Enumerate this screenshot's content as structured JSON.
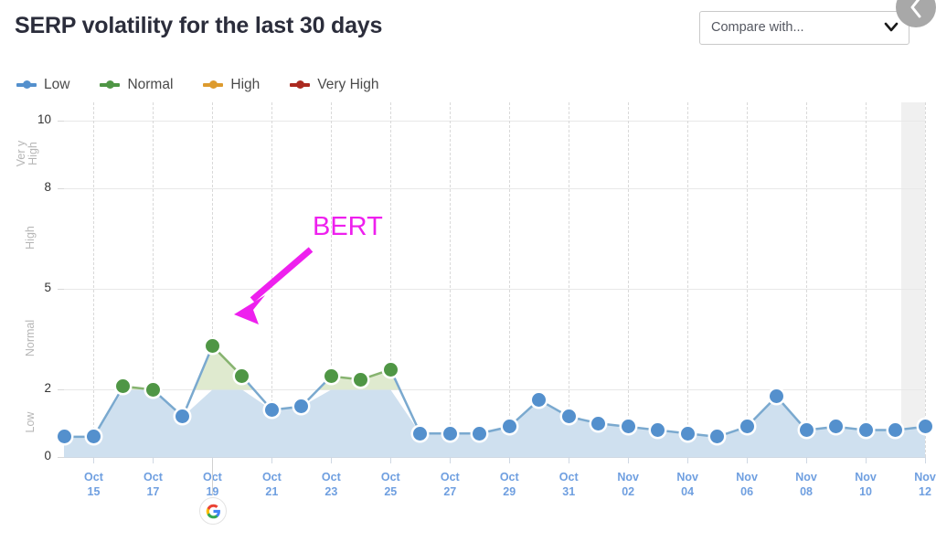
{
  "header": {
    "title": "SERP volatility for the last 30 days",
    "compare_placeholder": "Compare with...",
    "caret_icon": "chevron-down-icon",
    "collapse_icon": "chevron-left-icon"
  },
  "legend": {
    "items": [
      {
        "label": "Low",
        "color": "#5490cd"
      },
      {
        "label": "Normal",
        "color": "#4f9645"
      },
      {
        "label": "High",
        "color": "#dd9b2e"
      },
      {
        "label": "Very High",
        "color": "#ab2a20"
      }
    ]
  },
  "annotation": {
    "text": "BERT",
    "color": "#ee20ee"
  },
  "event_marker": {
    "icon": "google-logo-icon",
    "label": "Google"
  },
  "chart_data": {
    "type": "area",
    "title": "SERP volatility for the last 30 days",
    "xlabel": "",
    "ylabel": "",
    "ylim": [
      0,
      10
    ],
    "yticks": [
      0,
      2,
      5,
      8,
      10
    ],
    "grid": true,
    "legend_position": "top-left",
    "bands": [
      {
        "label": "Low",
        "from": 0,
        "to": 2,
        "color": "#5490cd"
      },
      {
        "label": "Normal",
        "from": 2,
        "to": 5,
        "color": "#4f9645"
      },
      {
        "label": "High",
        "from": 5,
        "to": 8,
        "color": "#dd9b2e"
      },
      {
        "label": "Very High",
        "from": 8,
        "to": 10,
        "color": "#ab2a20"
      }
    ],
    "xtick_labels": [
      "Oct\n15",
      "Oct\n17",
      "Oct\n19",
      "Oct\n21",
      "Oct\n23",
      "Oct\n25",
      "Oct\n27",
      "Oct\n29",
      "Oct\n31",
      "Nov\n02",
      "Nov\n04",
      "Nov\n06",
      "Nov\n08",
      "Nov\n10",
      "Nov\n12"
    ],
    "x": [
      "Oct 14",
      "Oct 15",
      "Oct 16",
      "Oct 17",
      "Oct 18",
      "Oct 19",
      "Oct 20",
      "Oct 21",
      "Oct 22",
      "Oct 23",
      "Oct 24",
      "Oct 25",
      "Oct 26",
      "Oct 27",
      "Oct 28",
      "Oct 29",
      "Oct 30",
      "Oct 31",
      "Nov 01",
      "Nov 02",
      "Nov 03",
      "Nov 04",
      "Nov 05",
      "Nov 06",
      "Nov 07",
      "Nov 08",
      "Nov 09",
      "Nov 10",
      "Nov 11",
      "Nov 12"
    ],
    "series": [
      {
        "name": "SERP volatility",
        "values": [
          0.6,
          0.6,
          2.1,
          2.0,
          1.2,
          3.3,
          2.4,
          1.4,
          1.5,
          2.4,
          2.3,
          2.6,
          0.7,
          0.7,
          0.7,
          0.9,
          1.7,
          1.2,
          1.0,
          0.9,
          0.8,
          0.7,
          0.6,
          0.9,
          1.8,
          0.8,
          0.9,
          0.8,
          0.8,
          0.9
        ],
        "point_levels": [
          "low",
          "low",
          "normal",
          "normal",
          "low",
          "normal",
          "normal",
          "low",
          "low",
          "normal",
          "normal",
          "normal",
          "low",
          "low",
          "low",
          "low",
          "low",
          "low",
          "low",
          "low",
          "low",
          "low",
          "low",
          "low",
          "low",
          "low",
          "low",
          "low",
          "low",
          "low"
        ]
      }
    ],
    "annotations": [
      {
        "text": "BERT",
        "points_to": "Oct 19",
        "color": "#ee20ee"
      }
    ],
    "events": [
      {
        "date": "Oct 19",
        "icon": "google-logo-icon"
      }
    ],
    "highlight_band": {
      "from": "Nov 11",
      "to": "Nov 12",
      "color": "#f0f0f0"
    }
  }
}
